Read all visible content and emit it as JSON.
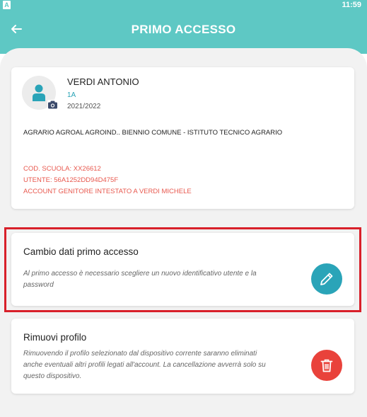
{
  "status_bar": {
    "left_icon_letter": "A",
    "time": "11:59"
  },
  "header": {
    "title": "PRIMO ACCESSO"
  },
  "profile": {
    "name": "VERDI ANTONIO",
    "class": "1A",
    "year": "2021/2022",
    "school": "AGRARIO AGROAL AGROIND.. BIENNIO COMUNE - ISTITUTO TECNICO AGRARIO",
    "school_code": "COD. SCUOLA: XX26612",
    "user": "UTENTE: 56A1252DD94D475F",
    "account_owner": "ACCOUNT GENITORE INTESTATO A VERDI MICHELE"
  },
  "change_card": {
    "title": "Cambio dati primo accesso",
    "description": "Al primo accesso è necessario scegliere un nuovo identificativo utente e la password"
  },
  "remove_card": {
    "title": "Rimuovi profilo",
    "description": "Rimuovendo il profilo selezionato dal dispositivo corrente saranno eliminati anche eventuali altri profili legati all'account. La cancellazione avverrà solo su questo dispositivo."
  },
  "colors": {
    "primary": "#5ec8c4",
    "accent": "#2aa4b8",
    "danger": "#e9423b",
    "info_text": "#e8584e",
    "highlight": "#d8202a"
  },
  "icons": {
    "back": "arrow-left-icon",
    "avatar": "person-icon",
    "camera": "camera-icon",
    "edit": "pencil-icon",
    "delete": "trash-icon"
  }
}
